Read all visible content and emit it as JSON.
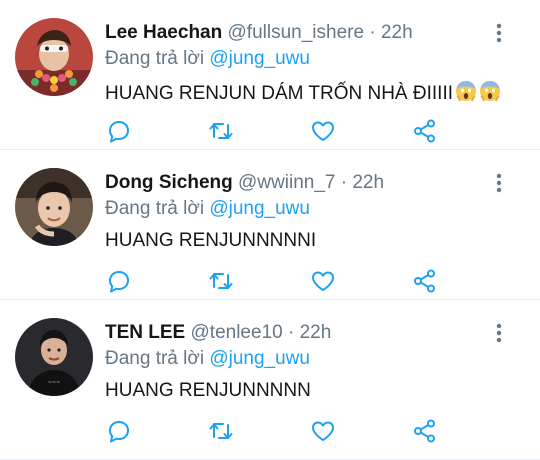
{
  "colors": {
    "mention": "#1da1f2",
    "muted": "#657786",
    "text": "#14171a",
    "divider": "#e6ecf0"
  },
  "tweets": [
    {
      "name": "Lee Haechan",
      "handle": "@fullsun_ishere",
      "sep": "·",
      "time": "22h",
      "reply_prefix": "Đang trả lời ",
      "reply_to": "@jung_uwu",
      "text": "HUANG RENJUN DÁM TRỐN NHÀ ĐIIIII",
      "emoji": [
        "face-screaming-icon",
        "face-screaming-icon"
      ]
    },
    {
      "name": "Dong Sicheng",
      "handle": "@wwiinn_7",
      "sep": "·",
      "time": "22h",
      "reply_prefix": "Đang trả lời ",
      "reply_to": "@jung_uwu",
      "text": "HUANG RENJUNNNNNI"
    },
    {
      "name": "TEN LEE",
      "handle": "@tenlee10",
      "sep": "·",
      "time": "22h",
      "reply_prefix": "Đang trả lời ",
      "reply_to": "@jung_uwu",
      "text": "HUANG RENJUNNNNN"
    }
  ],
  "action_icons": [
    "reply-icon",
    "retweet-icon",
    "like-icon",
    "share-icon"
  ]
}
